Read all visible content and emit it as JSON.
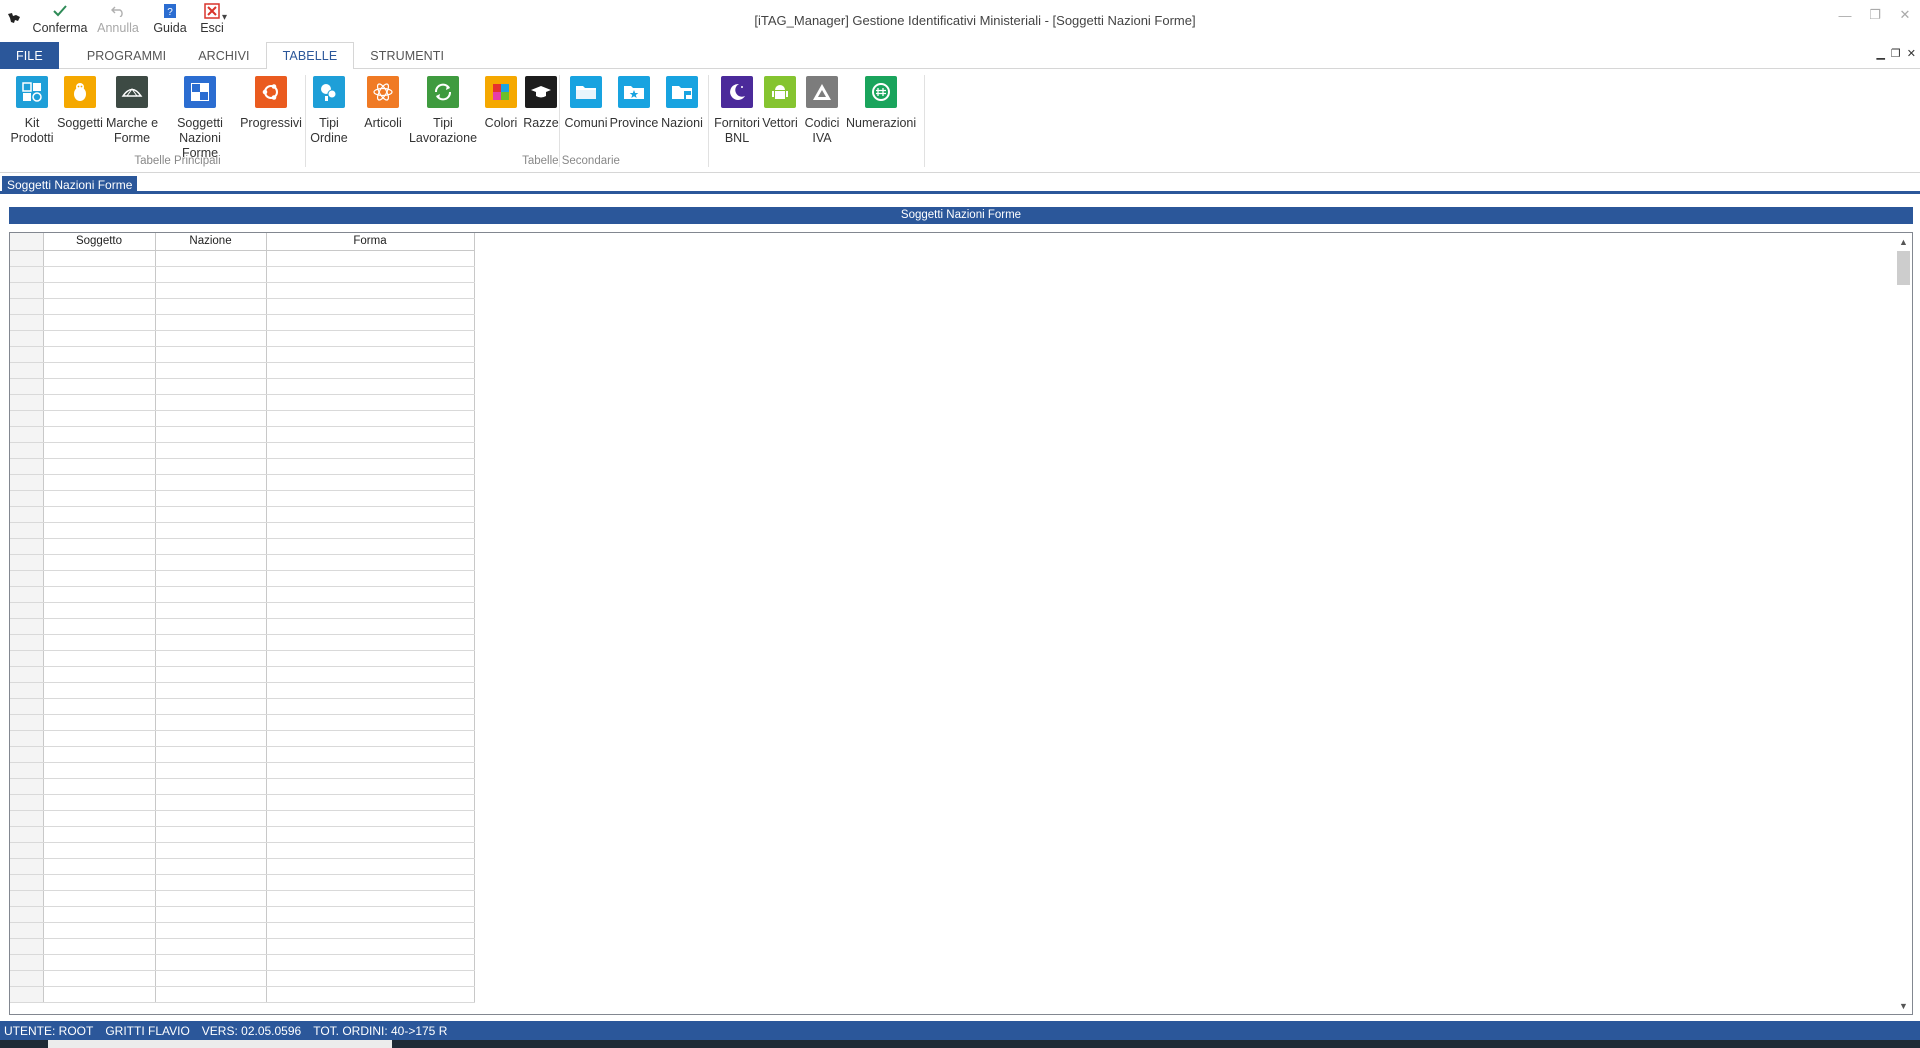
{
  "window": {
    "title": "[iTAG_Manager] Gestione Identificativi Ministeriali - [Soggetti Nazioni Forme]"
  },
  "quick_access": [
    {
      "label": "Conferma",
      "icon": "check-icon",
      "enabled": true
    },
    {
      "label": "Annulla",
      "icon": "undo-icon",
      "enabled": false
    },
    {
      "label": "Guida",
      "icon": "help-book-icon",
      "enabled": true
    },
    {
      "label": "Esci",
      "icon": "exit-icon",
      "enabled": true
    }
  ],
  "ribbon_tabs": [
    "FILE",
    "PROGRAMMI",
    "ARCHIVI",
    "TABELLE",
    "STRUMENTI"
  ],
  "active_tab": "TABELLE",
  "ribbon_groups": [
    {
      "label": "Tabelle Principali",
      "buttons": [
        {
          "label": "Kit Prodotti",
          "icon": "kit-products-icon",
          "color": "#1e9fd8"
        },
        {
          "label": "Soggetti",
          "icon": "penguin-icon",
          "color": "#f5a800"
        },
        {
          "label": "Marche e Forme",
          "icon": "brand-shapes-icon",
          "color": "#3d4a44"
        },
        {
          "label": "Soggetti Nazioni Forme",
          "icon": "grid-squares-icon",
          "color": "#2b6dd1"
        },
        {
          "label": "Progressivi",
          "icon": "ubuntu-icon",
          "color": "#ea5b1f"
        },
        {
          "label": "Tipi Ordine",
          "icon": "order-types-icon",
          "color": "#1e9fd8"
        }
      ]
    },
    {
      "label": "Tabelle Secondarie",
      "buttons": [
        {
          "label": "Articoli",
          "icon": "atom-icon",
          "color": "#f07a24"
        },
        {
          "label": "Tipi Lavorazione",
          "icon": "recycle-icon",
          "color": "#3f9b3f"
        },
        {
          "label": "Colori",
          "icon": "palette-icon",
          "color": "#f5a800"
        },
        {
          "label": "Razze",
          "icon": "graduation-cap-icon",
          "color": "#1c1c1c"
        },
        {
          "label": "Comuni",
          "icon": "folder-icon",
          "color": "#18a3e0"
        },
        {
          "label": "Province",
          "icon": "folder-star-icon",
          "color": "#18a3e0"
        },
        {
          "label": "Nazioni",
          "icon": "folder-flag-icon",
          "color": "#18a3e0"
        },
        {
          "label": "Fornitori BNL",
          "icon": "moon-icon",
          "color": "#4b2a9a"
        },
        {
          "label": "Vettori",
          "icon": "android-icon",
          "color": "#85c430"
        },
        {
          "label": "Codici IVA",
          "icon": "triangle-icon",
          "color": "#7c7c7c"
        },
        {
          "label": "Numerazioni",
          "icon": "numbers-icon",
          "color": "#1aa45c"
        }
      ]
    }
  ],
  "mdi_tab": "Soggetti Nazioni Forme",
  "panel": {
    "title": "Soggetti Nazioni Forme",
    "columns": [
      "Soggetto",
      "Nazione",
      "Forma"
    ]
  },
  "status": {
    "user": "UTENTE: ROOT",
    "name": "GRITTI FLAVIO",
    "version": "VERS: 02.05.0596",
    "orders": "TOT. ORDINI: 40->175 R"
  },
  "colors": {
    "accent": "#2b579a"
  }
}
